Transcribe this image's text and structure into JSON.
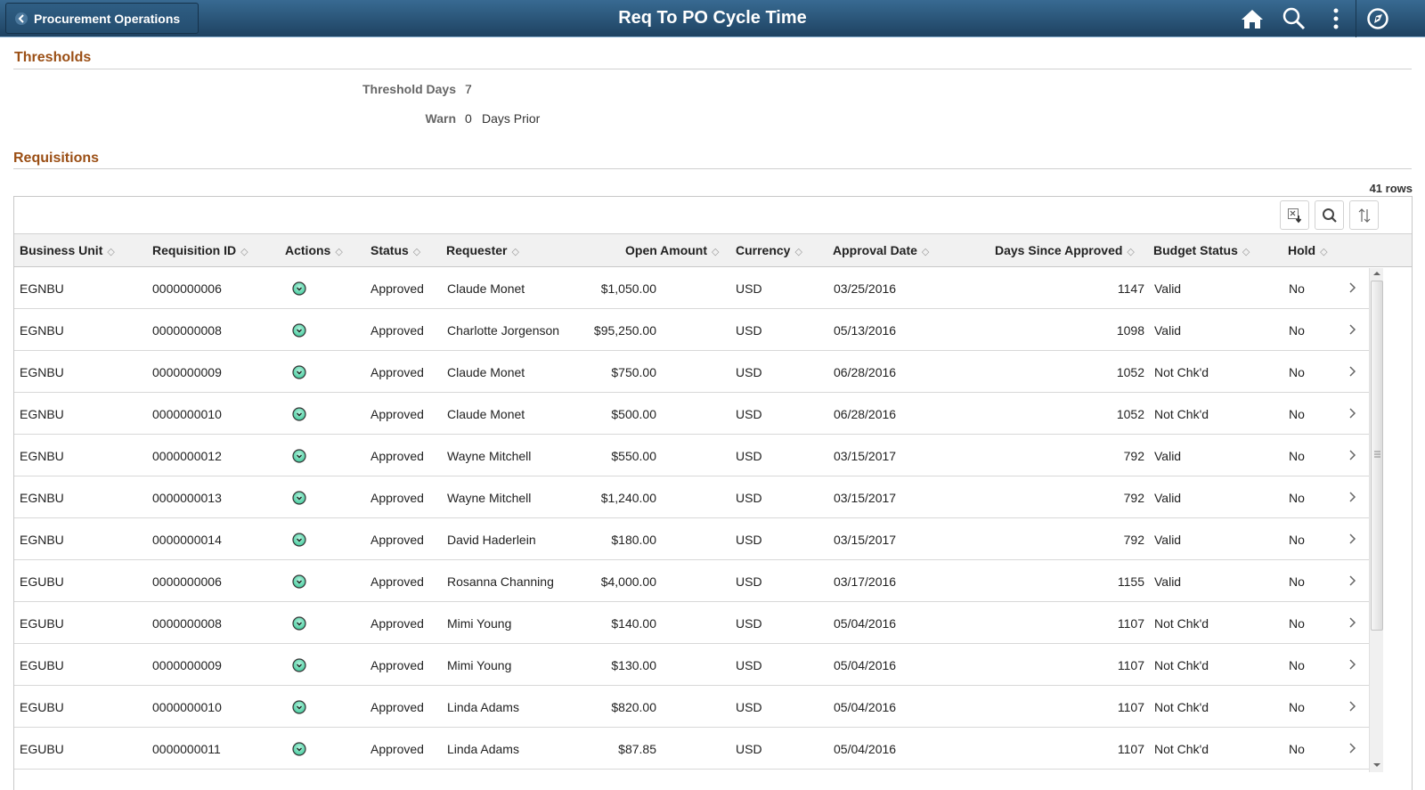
{
  "banner": {
    "back_label": "Procurement Operations",
    "title": "Req To PO Cycle Time",
    "icons": [
      "home-icon",
      "search-icon",
      "more-options-icon",
      "navbar-compass-icon"
    ]
  },
  "thresholds": {
    "section_title": "Thresholds",
    "threshold_days_label": "Threshold Days",
    "threshold_days_value": "7",
    "warn_label": "Warn",
    "warn_value": "0",
    "warn_suffix": "Days Prior"
  },
  "requisitions": {
    "section_title": "Requisitions",
    "row_count": "41 rows",
    "toolbar": [
      "download-to-excel-icon",
      "find-icon",
      "sort-icon"
    ],
    "columns": [
      "Business Unit",
      "Requisition ID",
      "Actions",
      "Status",
      "Requester",
      "Open Amount",
      "Currency",
      "Approval Date",
      "Days Since Approved",
      "Budget Status",
      "Hold"
    ],
    "rows": [
      {
        "bu": "EGNBU",
        "req_id": "0000000006",
        "status": "Approved",
        "requester": "Claude Monet",
        "amount": "$1,050.00",
        "currency": "USD",
        "date": "03/25/2016",
        "days": "1147",
        "budget": "Valid",
        "hold": "No"
      },
      {
        "bu": "EGNBU",
        "req_id": "0000000008",
        "status": "Approved",
        "requester": "Charlotte Jorgenson",
        "amount": "$95,250.00",
        "currency": "USD",
        "date": "05/13/2016",
        "days": "1098",
        "budget": "Valid",
        "hold": "No"
      },
      {
        "bu": "EGNBU",
        "req_id": "0000000009",
        "status": "Approved",
        "requester": "Claude Monet",
        "amount": "$750.00",
        "currency": "USD",
        "date": "06/28/2016",
        "days": "1052",
        "budget": "Not Chk'd",
        "hold": "No"
      },
      {
        "bu": "EGNBU",
        "req_id": "0000000010",
        "status": "Approved",
        "requester": "Claude Monet",
        "amount": "$500.00",
        "currency": "USD",
        "date": "06/28/2016",
        "days": "1052",
        "budget": "Not Chk'd",
        "hold": "No"
      },
      {
        "bu": "EGNBU",
        "req_id": "0000000012",
        "status": "Approved",
        "requester": "Wayne Mitchell",
        "amount": "$550.00",
        "currency": "USD",
        "date": "03/15/2017",
        "days": "792",
        "budget": "Valid",
        "hold": "No"
      },
      {
        "bu": "EGNBU",
        "req_id": "0000000013",
        "status": "Approved",
        "requester": "Wayne Mitchell",
        "amount": "$1,240.00",
        "currency": "USD",
        "date": "03/15/2017",
        "days": "792",
        "budget": "Valid",
        "hold": "No"
      },
      {
        "bu": "EGNBU",
        "req_id": "0000000014",
        "status": "Approved",
        "requester": "David Haderlein",
        "amount": "$180.00",
        "currency": "USD",
        "date": "03/15/2017",
        "days": "792",
        "budget": "Valid",
        "hold": "No"
      },
      {
        "bu": "EGUBU",
        "req_id": "0000000006",
        "status": "Approved",
        "requester": "Rosanna Channing",
        "amount": "$4,000.00",
        "currency": "USD",
        "date": "03/17/2016",
        "days": "1155",
        "budget": "Valid",
        "hold": "No"
      },
      {
        "bu": "EGUBU",
        "req_id": "0000000008",
        "status": "Approved",
        "requester": "Mimi Young",
        "amount": "$140.00",
        "currency": "USD",
        "date": "05/04/2016",
        "days": "1107",
        "budget": "Not Chk'd",
        "hold": "No"
      },
      {
        "bu": "EGUBU",
        "req_id": "0000000009",
        "status": "Approved",
        "requester": "Mimi Young",
        "amount": "$130.00",
        "currency": "USD",
        "date": "05/04/2016",
        "days": "1107",
        "budget": "Not Chk'd",
        "hold": "No"
      },
      {
        "bu": "EGUBU",
        "req_id": "0000000010",
        "status": "Approved",
        "requester": "Linda Adams",
        "amount": "$820.00",
        "currency": "USD",
        "date": "05/04/2016",
        "days": "1107",
        "budget": "Not Chk'd",
        "hold": "No"
      },
      {
        "bu": "EGUBU",
        "req_id": "0000000011",
        "status": "Approved",
        "requester": "Linda Adams",
        "amount": "$87.85",
        "currency": "USD",
        "date": "05/04/2016",
        "days": "1107",
        "budget": "Not Chk'd",
        "hold": "No"
      }
    ]
  },
  "colors": {
    "banner_top": "#386a92",
    "banner_bottom": "#1e4261",
    "section_title": "#9b4f15",
    "action_icon": "#5fd3b0"
  }
}
